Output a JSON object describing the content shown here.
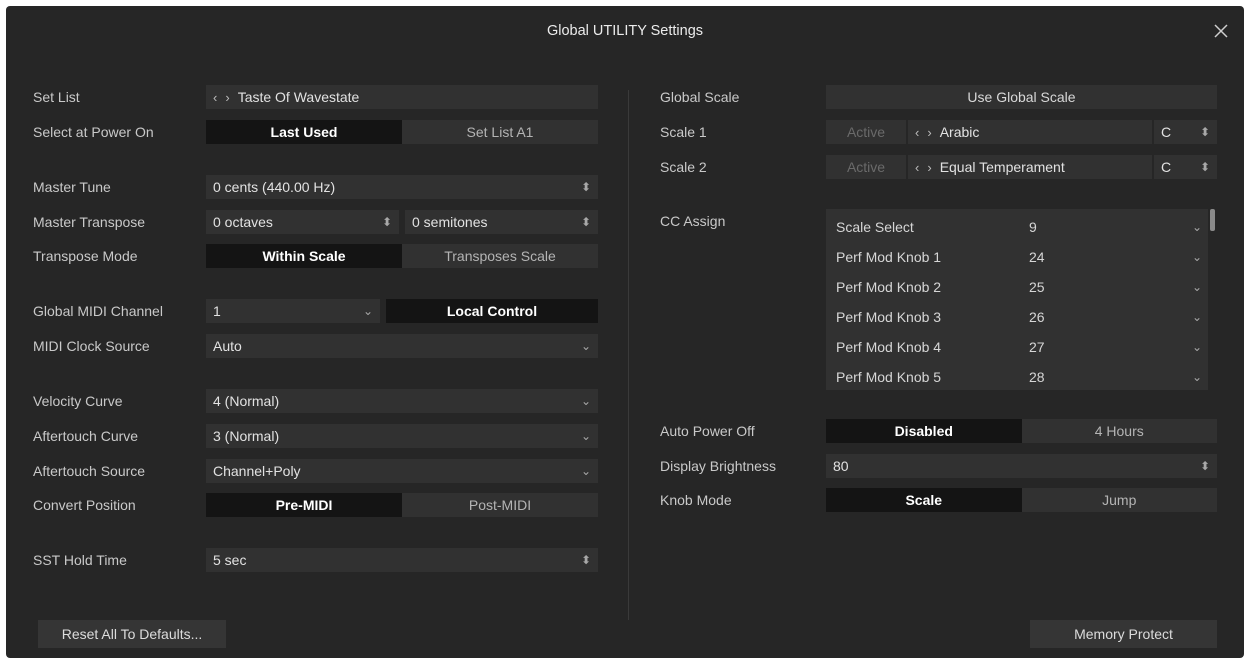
{
  "window": {
    "title": "Global UTILITY Settings"
  },
  "left": {
    "set_list": {
      "label": "Set List",
      "value": "Taste Of Wavestate"
    },
    "select_power_on": {
      "label": "Select at Power On",
      "options": [
        "Last Used",
        "Set List A1"
      ],
      "selected": "Last Used"
    },
    "master_tune": {
      "label": "Master Tune",
      "value": "0 cents (440.00 Hz)"
    },
    "master_transpose": {
      "label": "Master Transpose",
      "octaves": "0 octaves",
      "semitones": "0 semitones"
    },
    "transpose_mode": {
      "label": "Transpose Mode",
      "options": [
        "Within Scale",
        "Transposes Scale"
      ],
      "selected": "Within Scale"
    },
    "global_midi_channel": {
      "label": "Global MIDI Channel",
      "value": "1",
      "local_control": "Local Control"
    },
    "midi_clock_source": {
      "label": "MIDI Clock Source",
      "value": "Auto"
    },
    "velocity_curve": {
      "label": "Velocity Curve",
      "value": "4 (Normal)"
    },
    "aftertouch_curve": {
      "label": "Aftertouch Curve",
      "value": "3 (Normal)"
    },
    "aftertouch_source": {
      "label": "Aftertouch Source",
      "value": "Channel+Poly"
    },
    "convert_position": {
      "label": "Convert Position",
      "options": [
        "Pre-MIDI",
        "Post-MIDI"
      ],
      "selected": "Pre-MIDI"
    },
    "sst_hold_time": {
      "label": "SST Hold Time",
      "value": "5 sec"
    },
    "reset_button": "Reset All To Defaults..."
  },
  "right": {
    "global_scale": {
      "label": "Global Scale",
      "value": "Use Global Scale"
    },
    "scale1": {
      "label": "Scale 1",
      "active": "Active",
      "scale": "Arabic",
      "key": "C"
    },
    "scale2": {
      "label": "Scale 2",
      "active": "Active",
      "scale": "Equal Temperament",
      "key": "C"
    },
    "cc_assign": {
      "label": "CC Assign",
      "rows": [
        {
          "name": "Scale Select",
          "cc": "9"
        },
        {
          "name": "Perf Mod Knob 1",
          "cc": "24"
        },
        {
          "name": "Perf Mod Knob 2",
          "cc": "25"
        },
        {
          "name": "Perf Mod Knob 3",
          "cc": "26"
        },
        {
          "name": "Perf Mod Knob 4",
          "cc": "27"
        },
        {
          "name": "Perf Mod Knob 5",
          "cc": "28"
        }
      ]
    },
    "auto_power_off": {
      "label": "Auto Power Off",
      "options": [
        "Disabled",
        "4 Hours"
      ],
      "selected": "Disabled"
    },
    "display_brightness": {
      "label": "Display Brightness",
      "value": "80"
    },
    "knob_mode": {
      "label": "Knob Mode",
      "options": [
        "Scale",
        "Jump"
      ],
      "selected": "Scale"
    },
    "memory_protect_button": "Memory Protect"
  },
  "icons": {
    "close": "close-icon",
    "prev": "chevron-left-icon",
    "next": "chevron-right-icon",
    "dropdown": "chevron-down-icon",
    "stepper": "up-down-icon"
  },
  "colors": {
    "window_bg": "#262626",
    "field_bg": "#313131",
    "selected_bg": "#141414",
    "text": "#d6d6d6"
  }
}
